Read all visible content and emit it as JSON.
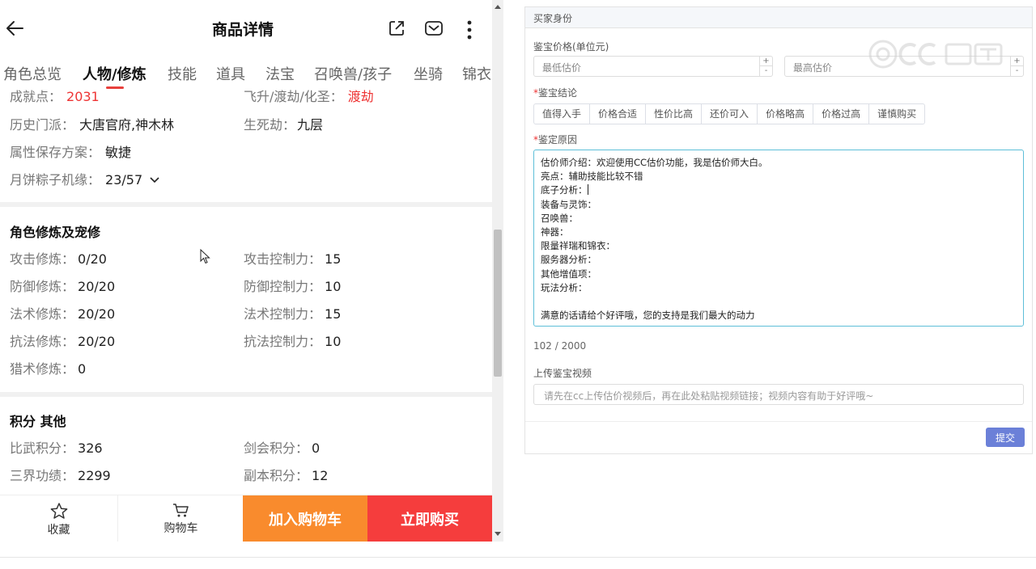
{
  "header": {
    "title": "商品详情"
  },
  "tabs": [
    {
      "label": "角色总览"
    },
    {
      "label": "人物/修炼"
    },
    {
      "label": "技能"
    },
    {
      "label": "道具"
    },
    {
      "label": "法宝"
    },
    {
      "label": "召唤兽/孩子"
    },
    {
      "label": "坐骑"
    },
    {
      "label": "锦衣"
    }
  ],
  "active_tab": "人物/修炼",
  "top_info": {
    "achievement_label": "成就点：",
    "achievement_value": "2031",
    "rebirth_label": "飞升/渡劫/化圣：",
    "rebirth_value": "渡劫",
    "sect_label": "历史门派：",
    "sect_value": "大唐官府,神木林",
    "calamity_label": "生死劫：",
    "calamity_value": "九层",
    "attr_label": "属性保存方案：",
    "attr_value": "敏捷",
    "fate_label": "月饼粽子机缘：",
    "fate_value": "23/57"
  },
  "cultivation": {
    "title": "角色修炼及宠修",
    "rows": [
      {
        "label": "攻击修炼：",
        "value": "0/20",
        "label2": "攻击控制力：",
        "value2": "15"
      },
      {
        "label": "防御修炼：",
        "value": "20/20",
        "label2": "防御控制力：",
        "value2": "10"
      },
      {
        "label": "法术修炼：",
        "value": "20/20",
        "label2": "法术控制力：",
        "value2": "15"
      },
      {
        "label": "抗法修炼：",
        "value": "20/20",
        "label2": "抗法控制力：",
        "value2": "10"
      },
      {
        "label": "猎术修炼：",
        "value": "0"
      }
    ]
  },
  "points": {
    "title": "积分 其他",
    "rows": [
      {
        "label": "比武积分：",
        "value": "326",
        "label2": "剑会积分：",
        "value2": "0"
      },
      {
        "label": "三界功绩：",
        "value": "2299",
        "label2": "副本积分：",
        "value2": "12"
      }
    ]
  },
  "bottom_bar": {
    "favorite": "收藏",
    "cart": "购物车",
    "add_to_cart": "加入购物车",
    "buy_now": "立即购买"
  },
  "form": {
    "section_title": "买家身份",
    "price_label": "鉴宝价格(单位元)",
    "min_placeholder": "最低估价",
    "max_placeholder": "最高估价",
    "conclusion_label": "鉴宝结论",
    "conclusion_options": [
      "值得入手",
      "价格合适",
      "性价比高",
      "还价可入",
      "价格略高",
      "价格过高",
      "谨慎购买"
    ],
    "reason_label": "鉴定原因",
    "reason_lines": [
      "估价师介绍：欢迎使用CC估价功能，我是估价师大白。",
      "亮点：辅助技能比较不错",
      "底子分析：",
      "装备与灵饰：",
      "召唤兽：",
      "神器：",
      "限量祥瑞和锦衣：",
      "服务器分析：",
      "其他增值项：",
      "玩法分析：",
      "",
      "满意的话请给个好评哦，您的支持是我们最大的动力"
    ],
    "char_count": "102 / 2000",
    "video_label": "上传鉴宝视频",
    "video_placeholder": "请先在cc上传估价视频后，再在此处粘贴视频链接；视频内容有助于好评哦~",
    "submit": "提交"
  },
  "colors": {
    "accent_red": "#e8403c",
    "cart_orange": "#f98b2d",
    "buy_red": "#f53d3d",
    "submit_blue": "#6b80d8",
    "focus_teal": "#5ebfd8"
  }
}
